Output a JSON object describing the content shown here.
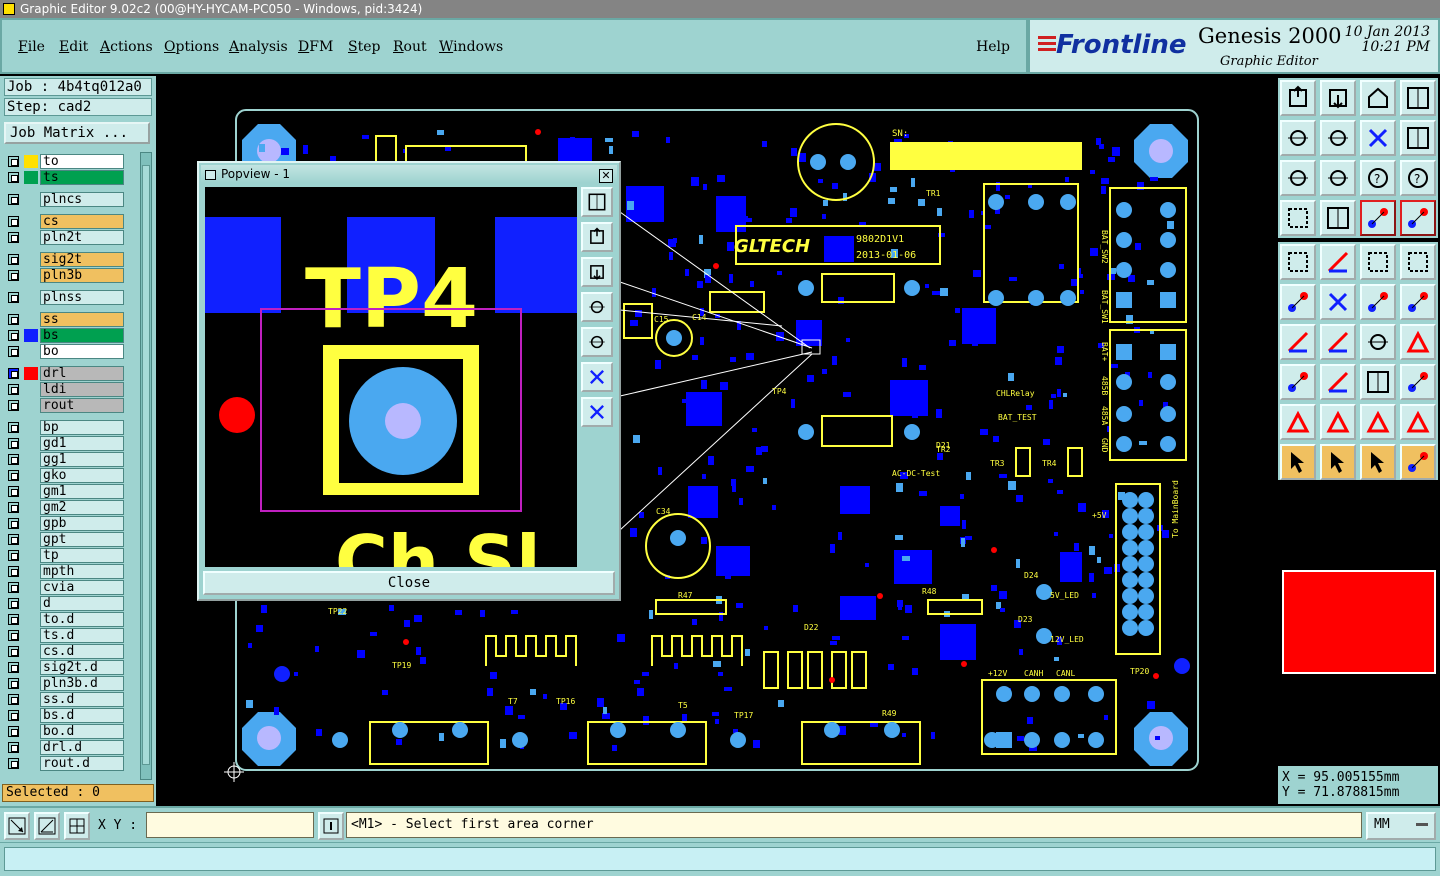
{
  "window": {
    "title": "Graphic Editor 9.02c2 (00@HY-HYCAM-PC050 - Windows, pid:3424)"
  },
  "menu": {
    "items": [
      "File",
      "Edit",
      "Actions",
      "Options",
      "Analysis",
      "DFM",
      "Step",
      "Rout",
      "Windows"
    ],
    "help": "Help"
  },
  "brand": {
    "logo": "Frontline",
    "product": "Genesis 2000",
    "subtitle": "Graphic Editor",
    "date": "10 Jan 2013",
    "time": "10:21 PM"
  },
  "job": {
    "job_line": "Job : 4b4tq012a0",
    "step_line": "Step: cad2",
    "matrix_button": "Job Matrix ..."
  },
  "layers": [
    {
      "name": "to",
      "swatch": "#ffe000",
      "fill": "#ffffff",
      "flag": true
    },
    {
      "name": "ts",
      "swatch": "#00a050",
      "fill": "#00a050"
    },
    {
      "name": "plncs",
      "fill": "#cfeceb"
    },
    {
      "name": "cs",
      "fill": "#f0c060"
    },
    {
      "name": "pln2t",
      "fill": "#cfeceb"
    },
    {
      "name": "sig2t",
      "fill": "#f0c060"
    },
    {
      "name": "pln3b",
      "fill": "#f0c060"
    },
    {
      "name": "plnss",
      "fill": "#cfeceb"
    },
    {
      "name": "ss",
      "fill": "#f0c060"
    },
    {
      "name": "bs",
      "swatch": "#1020ff",
      "fill": "#00a050"
    },
    {
      "name": "bo",
      "fill": "#ffffff",
      "flag": true
    },
    {
      "name": "drl",
      "swatch": "#ff0000",
      "fill": "#b8b8b8",
      "active": true,
      "flag": true
    },
    {
      "name": "ldi",
      "fill": "#b8b8b8"
    },
    {
      "name": "rout",
      "fill": "#b8b8b8"
    },
    {
      "name": "bp",
      "fill": "#cfeceb"
    },
    {
      "name": "gd1",
      "fill": "#cfeceb"
    },
    {
      "name": "gg1",
      "fill": "#cfeceb"
    },
    {
      "name": "gko",
      "fill": "#cfeceb"
    },
    {
      "name": "gm1",
      "fill": "#cfeceb"
    },
    {
      "name": "gm2",
      "fill": "#cfeceb"
    },
    {
      "name": "gpb",
      "fill": "#cfeceb"
    },
    {
      "name": "gpt",
      "fill": "#cfeceb"
    },
    {
      "name": "tp",
      "fill": "#cfeceb"
    },
    {
      "name": "mpth",
      "fill": "#cfeceb"
    },
    {
      "name": "cvia",
      "fill": "#cfeceb"
    },
    {
      "name": "d",
      "fill": "#cfeceb"
    },
    {
      "name": "to.d",
      "fill": "#cfeceb"
    },
    {
      "name": "ts.d",
      "fill": "#cfeceb"
    },
    {
      "name": "cs.d",
      "fill": "#cfeceb"
    },
    {
      "name": "sig2t.d",
      "fill": "#cfeceb"
    },
    {
      "name": "pln3b.d",
      "fill": "#cfeceb"
    },
    {
      "name": "ss.d",
      "fill": "#cfeceb"
    },
    {
      "name": "bs.d",
      "fill": "#cfeceb"
    },
    {
      "name": "bo.d",
      "fill": "#cfeceb"
    },
    {
      "name": "drl.d",
      "fill": "#cfeceb"
    },
    {
      "name": "rout.d",
      "fill": "#cfeceb"
    }
  ],
  "selected": "Selected : 0",
  "popup": {
    "title": "Popview - 1",
    "close_label": "Close",
    "zoom_text": "TP4",
    "zoom_text_bottom": "Ch   Sl"
  },
  "board_labels": [
    "SN:",
    "GLTECH",
    "9802D1V1",
    "2013-01-06",
    "BAT_SW2",
    "BAT_SW1",
    "BAT+",
    "485B",
    "485A",
    "GND",
    "+5V",
    "To MainBoard",
    "5V_LED",
    "12V_LED",
    "+12V",
    "CANH",
    "CANL",
    "AC-DC-Test",
    "BAT_TEST",
    "CHLRelay",
    "TR1",
    "TR2",
    "TR3",
    "TR4",
    "TP4",
    "TP22",
    "TP19",
    "TP20",
    "R47",
    "R48",
    "R49",
    "D21",
    "D22",
    "D23",
    "D24",
    "C14",
    "C15",
    "C34",
    "T5",
    "T7",
    "TP16",
    "TP17"
  ],
  "coords": {
    "x": "X = 95.005155mm",
    "y": "Y = 71.878815mm"
  },
  "status": {
    "xy_label": "X Y :",
    "xy_value": "",
    "message": "<M1> - Select first area corner",
    "units": "MM"
  },
  "colors": {
    "panel": "#9ed3d0",
    "board_fill": "#0000ff",
    "silk": "#ffff40",
    "pad": "#4aa8f0",
    "drill": "#ff0000"
  },
  "icons": {
    "right_toolbar_1": [
      "layer-up-icon",
      "layer-down-icon",
      "home-icon",
      "window-icon",
      "snap-left-icon",
      "snap-right-icon",
      "swap-icon",
      "scale-icon",
      "fit-icon",
      "center-icon",
      "ratio-icon",
      "query-icon",
      "measure-icon",
      "grid-icon",
      "net-icon",
      "net-alt-icon"
    ],
    "right_toolbar_2": [
      "select-icon",
      "angle-icon",
      "ruler-icon",
      "frame-icon",
      "connect-icon",
      "cross-icon",
      "move-icon",
      "move-copy-icon",
      "angle-line-icon",
      "line-icon",
      "arc-icon",
      "text-icon",
      "pad-icon",
      "cut-icon",
      "dimension-icon",
      "group-icon",
      "triangle-icon",
      "triangle-plus-icon",
      "bridge-icon",
      "bridge-alt-icon",
      "pointer-icon",
      "pointer-box-icon",
      "pointer-plus-icon",
      "route-icon"
    ],
    "popup_toolbar": [
      "zoom-page-icon",
      "zoom-up-icon",
      "zoom-down-icon",
      "pan-left-icon",
      "pan-right-icon",
      "zoom-in-icon",
      "zoom-out-icon"
    ]
  }
}
